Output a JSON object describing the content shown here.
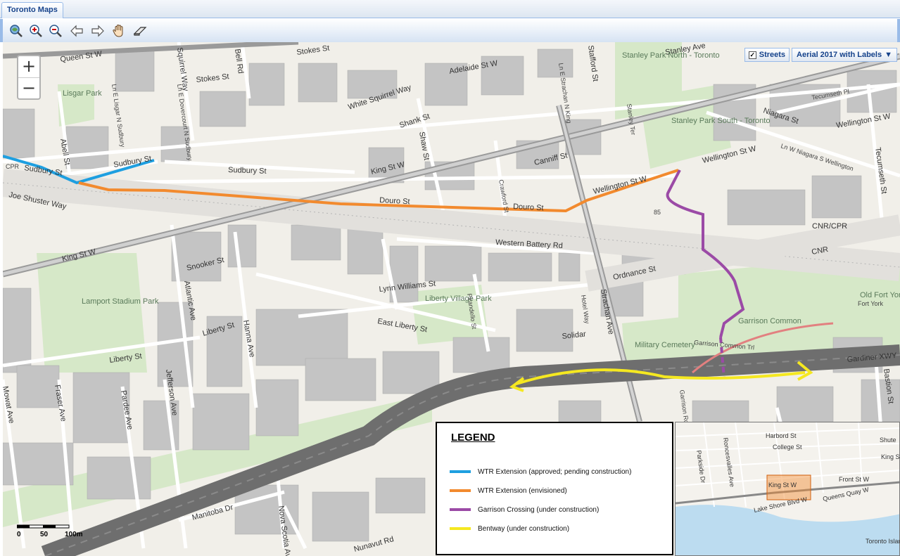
{
  "tab": {
    "title": "Toronto Maps"
  },
  "toolbar": {
    "tools": [
      {
        "name": "full-extent-icon"
      },
      {
        "name": "zoom-in-icon"
      },
      {
        "name": "zoom-out-icon"
      },
      {
        "name": "back-arrow-icon"
      },
      {
        "name": "forward-arrow-icon"
      },
      {
        "name": "pan-hand-icon"
      },
      {
        "name": "eraser-icon"
      }
    ]
  },
  "map": {
    "zoom_in": "+",
    "zoom_out": "−",
    "layers": {
      "streets_label": "Streets",
      "streets_checked": "✓",
      "basemap_value": "Aerial 2017 with Labels"
    },
    "scale": {
      "t0": "0",
      "t1": "50",
      "t2": "100m"
    },
    "labels": {
      "queen": "Queen St W",
      "stokes1": "Stokes St",
      "stokes2": "Stokes St",
      "stanley_ave": "Stanley Ave",
      "adelaide": "Adelaide St W",
      "abell": "Abell St",
      "lisgar": "Lisgar Park",
      "sudbury1": "Sudbury St",
      "sudbury2": "Sudbury St",
      "sudbury3": "Sudbury St",
      "white_squirrel": "White Squirrel Way",
      "shank": "Shank St",
      "shaw": "Shaw St",
      "king1": "King St W",
      "king2": "King St W",
      "canniff": "Canniff St",
      "crawford": "Crawford St",
      "douro1": "Douro St",
      "douro2": "Douro St",
      "wellington1": "Wellington St W",
      "wellington2": "Wellington St W",
      "wellington3": "Wellington St W",
      "niagara": "Niagara St",
      "stanley_north": "Stanley Park North - Toronto",
      "stanley_south": "Stanley Park South - Toronto",
      "joe_shuster": "Joe Shuster Way",
      "cnr_cpr": "CNR/CPR",
      "cnr": "CNR",
      "cpr": "CPR",
      "western_battery": "Western Battery Rd",
      "snooker": "Snooker St",
      "atlantic": "Atlantic Ave",
      "lamport": "Lamport Stadium Park",
      "lynn": "Lynn Williams St",
      "liberty_village": "Liberty Village Park",
      "pirandello": "Pirandello St",
      "ordnance": "Ordnance St",
      "strachan": "Strachan Ave",
      "east_liberty": "East Liberty St",
      "liberty1": "Liberty St",
      "liberty2": "Liberty St",
      "hanna": "Hanna Ave",
      "jefferson": "Jefferson Ave",
      "fraser": "Fraser Ave",
      "pardee": "Pardee Ave",
      "mowat": "Mowat Ave",
      "solidar": "Solidar",
      "military": "Military Cemetery",
      "garrison_common": "Garrison Common",
      "garrison_tri": "Garrison Common Trl",
      "old_fort": "Old Fort York",
      "gardiner": "Gardiner XWY",
      "bastion": "Bastion St",
      "tecumseth1": "Tecumseth St",
      "tecumseth2": "Tecumseth Pl",
      "manitoba": "Manitoba Dr",
      "nova_scotia": "Nova Scotia Ave",
      "nunavut": "Nunavut Rd",
      "bell": "Bell Rd",
      "stafford": "Stafford St",
      "stanley_ter": "Stanley Ter",
      "ln_strachan": "Ln E Strachan N King",
      "ln_niagara": "Ln W Niagara S Wellington",
      "ln_lisgar": "Ln E Lisgar N Sudbury",
      "ln_dovercourt": "Ln E Dovercourt N Sudbury",
      "squirrel": "Squirrel Way",
      "hotel": "Hotel Way",
      "fort_york": "Fort York",
      "garrison_rd": "Garrison Rd",
      "num85": "85"
    },
    "colors": {
      "wtr_approved": "#1e9fe0",
      "wtr_envisioned": "#f28a2e",
      "garrison": "#9b4aa6",
      "bentway": "#f5e820"
    }
  },
  "legend": {
    "title": "LEGEND",
    "items": [
      {
        "label": "WTR Extension (approved; pending construction)",
        "color": "#1e9fe0"
      },
      {
        "label": "WTR Extension (envisioned)",
        "color": "#f28a2e"
      },
      {
        "label": "Garrison Crossing (under construction)",
        "color": "#9b4aa6"
      },
      {
        "label": "Bentway (under construction)",
        "color": "#f5e820"
      }
    ]
  },
  "overview": {
    "harbord": "Harbord St",
    "college": "College St",
    "king": "King St W",
    "front": "Front St W",
    "queens_quay": "Queens Quay W",
    "lakeshore": "Lake Shore Blvd W",
    "shute": "Shute",
    "king2": "King St",
    "parkside": "Parkside Dr",
    "roncesvalles": "Roncesvalles Ave",
    "toronto_island": "Toronto Island"
  }
}
